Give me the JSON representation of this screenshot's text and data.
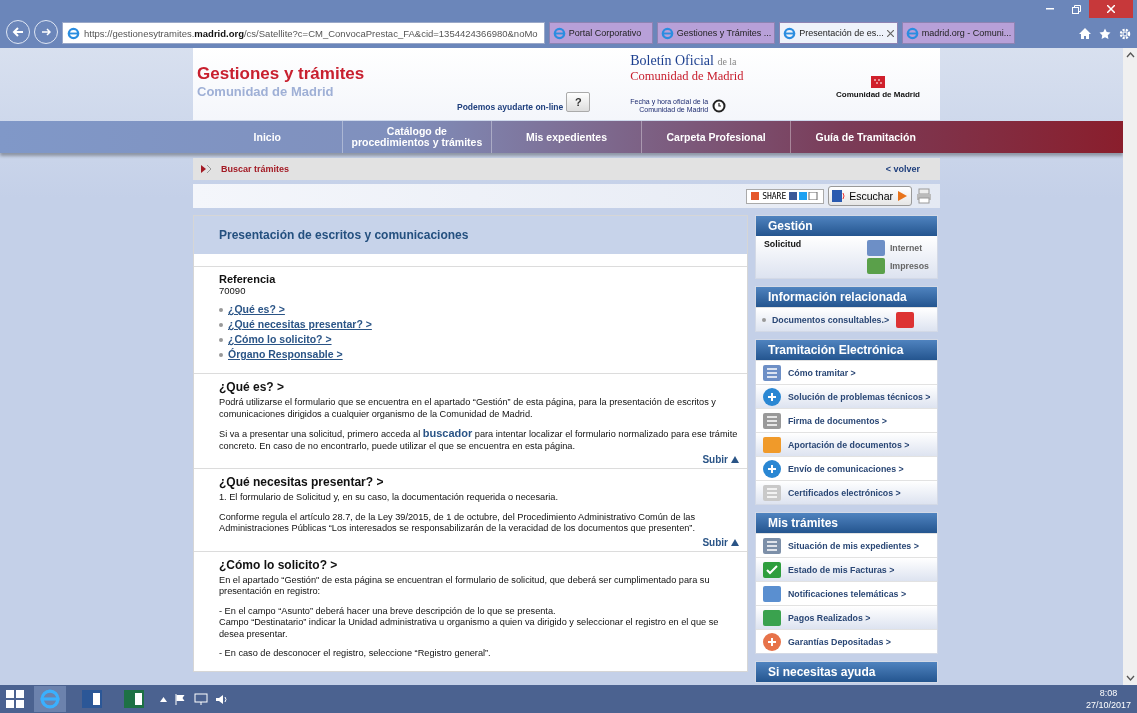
{
  "browser": {
    "url_prefix": "https://gestionesytramites.",
    "url_domain": "madrid.org",
    "url_rest": "/cs/Satellite?c=CM_ConvocaPrestac_FA&cid=1354424366980&noMo",
    "tabs": [
      {
        "title": "Portal Corporativo",
        "selected": false
      },
      {
        "title": "Gestiones y Trámites ...",
        "selected": false
      },
      {
        "title": "Presentación de es...",
        "selected": true
      },
      {
        "title": "madrid.org - Comuni...",
        "selected": false
      }
    ]
  },
  "header": {
    "title": "Gestiones y trámites",
    "subtitle": "Comunidad de Madrid",
    "help_label": "Podemos ayudarte on-line",
    "help_mark": "?",
    "boletin_main": "Boletín Oficial",
    "boletin_suffix": "de la",
    "boletin_line2": "Comunidad de Madrid",
    "clock_line1": "Fecha y hora oficial de la",
    "clock_line2": "Comunidad de Madrid",
    "logo_text": "Comunidad de Madrid"
  },
  "nav": [
    {
      "label": "Inicio"
    },
    {
      "label": "Catálogo de procedimientos y trámites"
    },
    {
      "label": "Mis expedientes"
    },
    {
      "label": "Carpeta Profesional"
    },
    {
      "label": "Guía de Tramitación"
    }
  ],
  "breadcrumb": {
    "label": "Buscar trámites",
    "back": "< volver"
  },
  "share": {
    "share_label": "SHARE",
    "listen_label": "Escuchar"
  },
  "content": {
    "title": "Presentación de escritos y comunicaciones",
    "reference_label": "Referencia",
    "reference_value": "70090",
    "links": [
      "¿Qué es? >",
      "¿Qué necesitas presentar? >",
      "¿Cómo lo solicito? >",
      "Órgano Responsable >"
    ],
    "sections": [
      {
        "heading": "¿Qué es? >",
        "paragraphs": [
          "Podrá utilizarse el formulario que se encuentra en el apartado “Gestión” de esta página, para la presentación de escritos y comunicaciones dirigidos a cualquier organismo de la Comunidad de Madrid.",
          "Si va a presentar una solicitud, primero acceda al **buscador** para intentar localizar el formulario normalizado para ese trámite concreto. En caso de no encontrarlo, puede utilizar el que se encuentra en esta página."
        ],
        "subir": "Subir"
      },
      {
        "heading": "¿Qué necesitas presentar? >",
        "paragraphs": [
          "1. El formulario de Solicitud y, en su caso, la documentación requerida o necesaria.",
          "Conforme regula el artículo 28.7, de la Ley 39/2015, de 1 de octubre, del Procedimiento Administrativo Común de las Administraciones Públicas “Los interesados se responsabilizarán de la veracidad de los documentos que presenten”."
        ],
        "subir": "Subir"
      },
      {
        "heading": "¿Cómo lo solicito? >",
        "paragraphs": [
          "En el apartado “Gestión\" de esta página se encuentran el formulario de solicitud, que deberá ser cumplimentado para su presentación en registro:",
          "- En el campo “Asunto” deberá hacer una breve descripción de lo que se presenta.\nCampo “Destinatario” indicar la Unidad administrativa u organismo a quien va dirigido y seleccionar el registro en el que se desea presentar.",
          "- En caso de desconocer el registro, seleccione “Registro general”."
        ]
      }
    ]
  },
  "sidebar": [
    {
      "title": "Gestión",
      "kind": "gestion",
      "label": "Solicitud",
      "items": [
        "Internet",
        "Impresos"
      ]
    },
    {
      "title": "Información relacionada",
      "kind": "bullets",
      "items": [
        "Documentos consultables.>"
      ]
    },
    {
      "title": "Tramitación Electrónica",
      "kind": "icons",
      "items": [
        "Cómo tramitar >",
        "Solución de problemas técnicos >",
        "Firma de documentos >",
        "Aportación de documentos >",
        "Envío de comunicaciones >",
        "Certificados electrónicos >"
      ]
    },
    {
      "title": "Mis trámites",
      "kind": "icons",
      "items": [
        "Situación de mis expedientes >",
        "Estado de mis Facturas >",
        "Notificaciones telemáticas >",
        "Pagos Realizados >",
        "Garantías Depositadas >"
      ]
    },
    {
      "title": "Si necesitas ayuda",
      "kind": "icons"
    }
  ],
  "taskbar": {
    "time": "8:08",
    "date": "27/10/2017"
  }
}
